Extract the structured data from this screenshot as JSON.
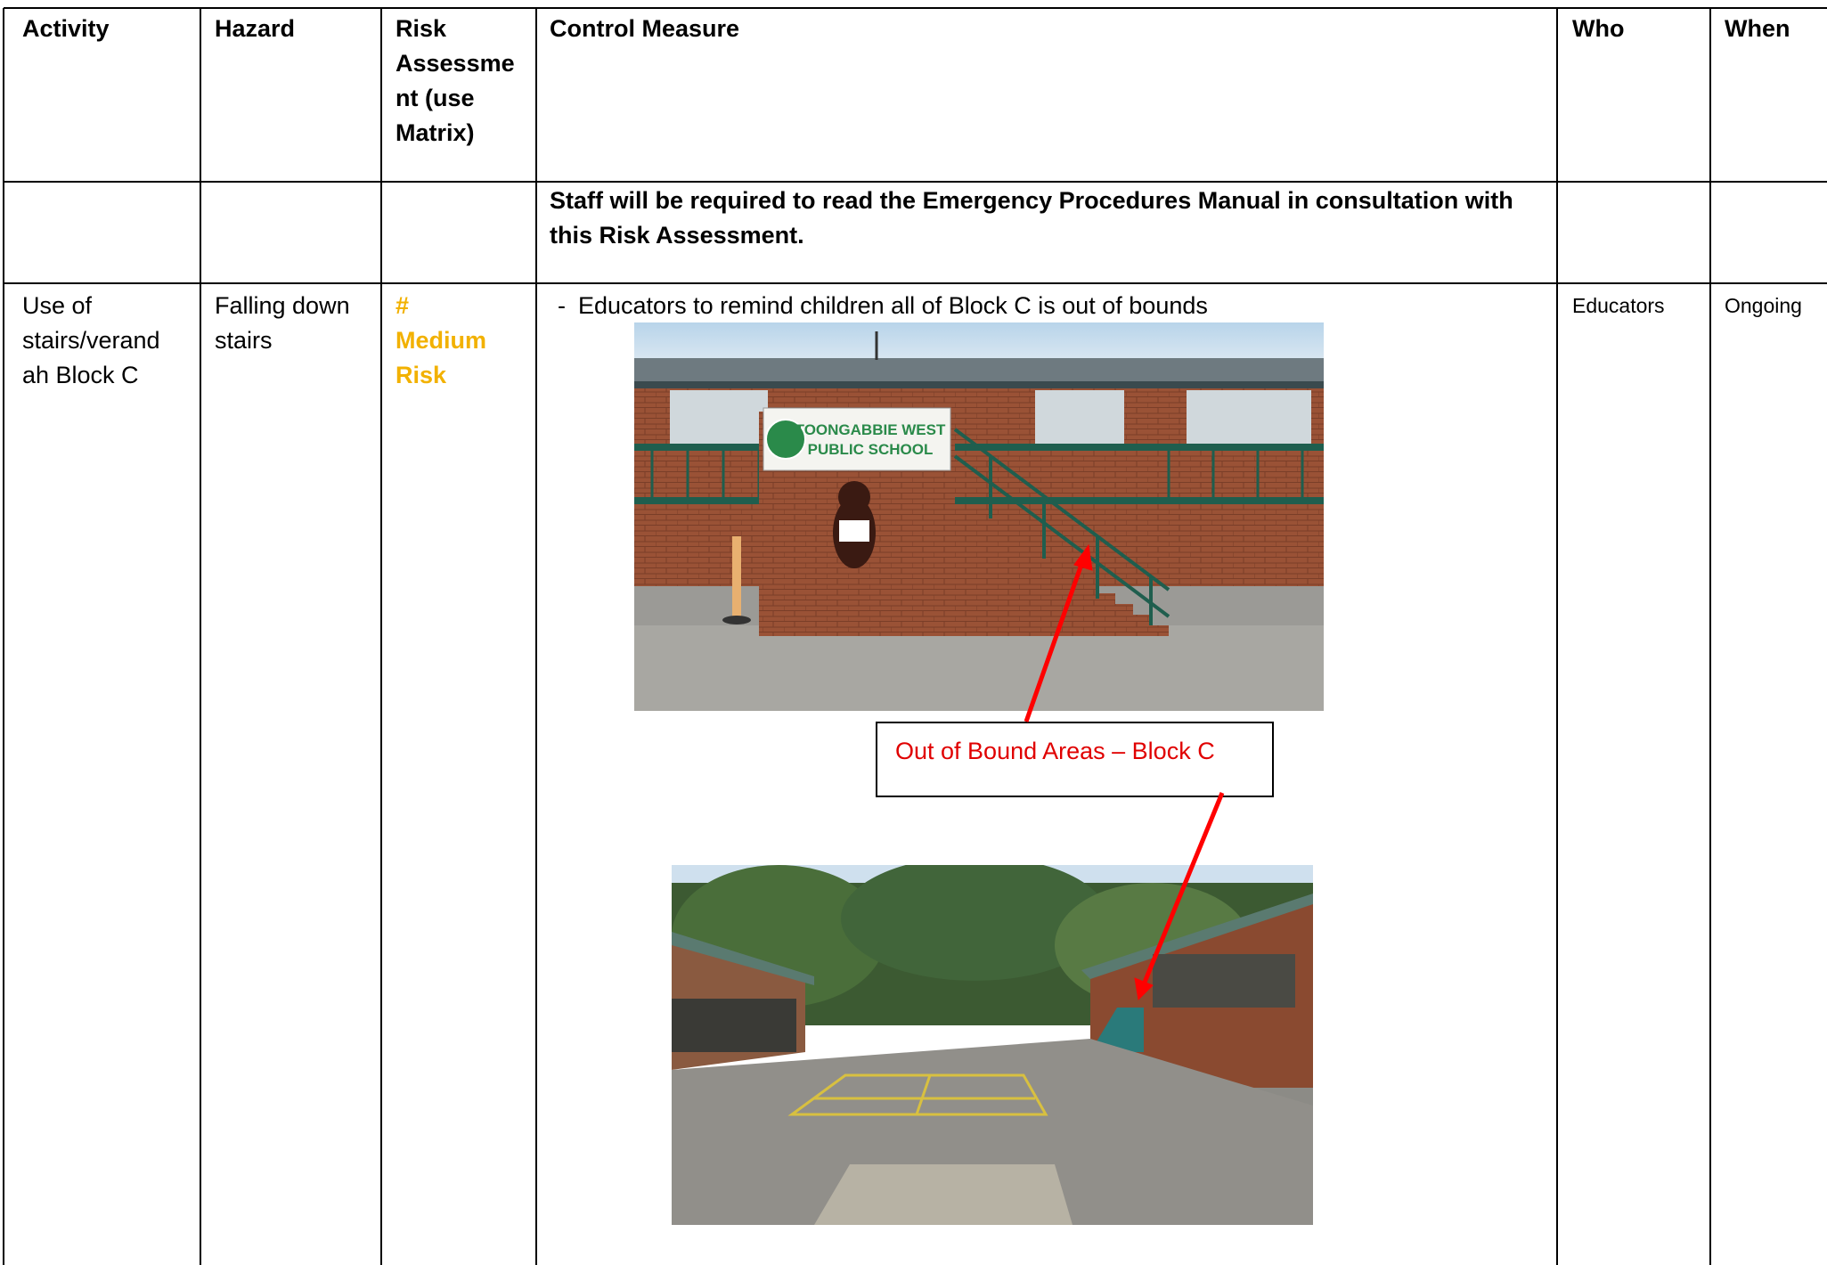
{
  "headers": {
    "activity": "Activity",
    "hazard": "Hazard",
    "risk_assessment": "Risk Assessme nt (use Matrix)",
    "control_measure": "Control Measure",
    "who": "Who",
    "when": "When"
  },
  "notice_row": {
    "text": "Staff will be required to read the Emergency Procedures Manual in consultation with this Risk Assessment."
  },
  "row": {
    "activity": "Use of stairs/verand ah Block C",
    "hazard": "Falling down stairs",
    "risk_symbol": "#",
    "risk_level": "Medium Risk",
    "control_bullet": "-",
    "control_text": "Educators to remind children all of Block C is out of bounds",
    "who": "Educators",
    "when": "Ongoing"
  },
  "photo_top": {
    "sign_line1": "TOONGABBIE WEST",
    "sign_line2": "PUBLIC SCHOOL"
  },
  "callout": {
    "text": "Out of Bound Areas – Block C"
  },
  "colors": {
    "risk_medium": "#f2b100",
    "callout_text": "#e00000",
    "arrow": "#ff0000"
  }
}
